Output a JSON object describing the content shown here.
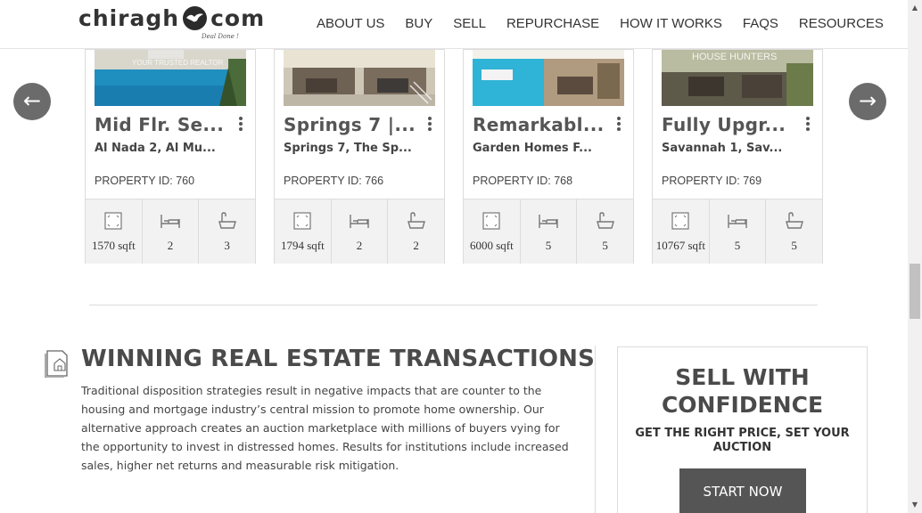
{
  "header": {
    "logo": {
      "left": "chiragh",
      "right": "com",
      "tagline": "Deal Done !"
    },
    "nav": [
      "ABOUT US",
      "BUY",
      "SELL",
      "REPURCHASE",
      "HOW IT WORKS",
      "FAQS",
      "RESOURCES"
    ]
  },
  "carousel": {
    "prev_label": "←",
    "next_label": "→",
    "cards": [
      {
        "title": "Mid Flr. Se...",
        "location": "Al Nada 2, Al Mu...",
        "property_id": "PROPERTY ID: 760",
        "area": "1570 sqft",
        "beds": "2",
        "baths": "3",
        "image_overlay_text": "YOUR TRUSTED REALTOR",
        "image_theme": "pool"
      },
      {
        "title": "Springs 7 |...",
        "location": "Springs 7, The Sp...",
        "property_id": "PROPERTY ID: 766",
        "area": "1794 sqft",
        "beds": "2",
        "baths": "2",
        "image_overlay_text": "",
        "image_theme": "garage"
      },
      {
        "title": "Remarkabl...",
        "location": "Garden Homes F...",
        "property_id": "PROPERTY ID: 768",
        "area": "6000 sqft",
        "beds": "5",
        "baths": "5",
        "image_overlay_text": "",
        "image_theme": "pool-deck"
      },
      {
        "title": "Fully Upgr...",
        "location": "Savannah 1, Sav...",
        "property_id": "PROPERTY ID: 769",
        "area": "10767 sqft",
        "beds": "5",
        "baths": "5",
        "image_overlay_text": "HOUSE HUNTERS",
        "image_theme": "patio"
      }
    ]
  },
  "winning": {
    "icon": "document-house-icon",
    "title": "WINNING REAL ESTATE TRANSACTIONS",
    "body": "Traditional disposition strategies result in negative impacts that are counter to the housing and mortgage industry’s central mission to promote home ownership. Our alternative approach creates an auction marketplace with millions of buyers vying for the opportunity to invest in distressed homes. Results for institutions include increased sales, higher net returns and measurable risk mitigation."
  },
  "sell": {
    "title_line1": "SELL WITH",
    "title_line2": "CONFIDENCE",
    "subtitle": "GET THE RIGHT PRICE, SET YOUR AUCTION",
    "button": "START NOW"
  },
  "colors": {
    "accent_dark": "#555555",
    "arrow_bg": "#6b6b6b",
    "stat_bg": "#f2f2f2"
  }
}
